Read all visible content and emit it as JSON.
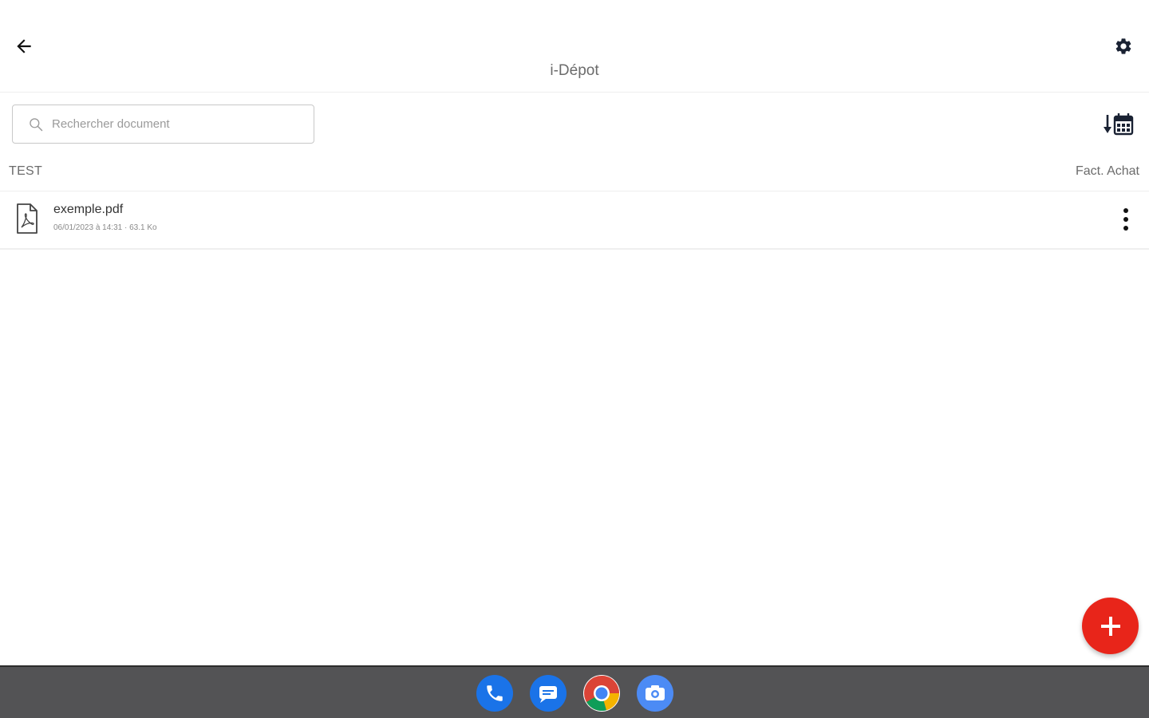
{
  "header": {
    "title": "i-Dépot",
    "back_icon": "arrow-left-icon",
    "settings_icon": "gear-icon"
  },
  "search": {
    "placeholder": "Rechercher document",
    "value": "",
    "icon": "search-icon"
  },
  "sort": {
    "icon": "sort-by-date-icon"
  },
  "section": {
    "left_label": "TEST",
    "right_label": "Fact. Achat"
  },
  "documents": [
    {
      "name": "exemple.pdf",
      "meta": "06/01/2023 à 14:31 · 63.1 Ko",
      "icon": "pdf-file-icon"
    }
  ],
  "fab": {
    "icon": "plus-icon",
    "color": "#e8251a"
  },
  "taskbar": {
    "apps": [
      {
        "name": "phone",
        "icon": "phone-icon",
        "color": "#1a73e8"
      },
      {
        "name": "messages",
        "icon": "messages-icon",
        "color": "#1a73e8"
      },
      {
        "name": "chrome",
        "icon": "chrome-icon",
        "color": "#4285f4"
      },
      {
        "name": "camera",
        "icon": "camera-icon",
        "color": "#4c8bf5"
      }
    ]
  },
  "colors": {
    "accent": "#e8251a",
    "taskbar": "#535355",
    "text": "#333333",
    "muted": "#6b6b6b"
  }
}
